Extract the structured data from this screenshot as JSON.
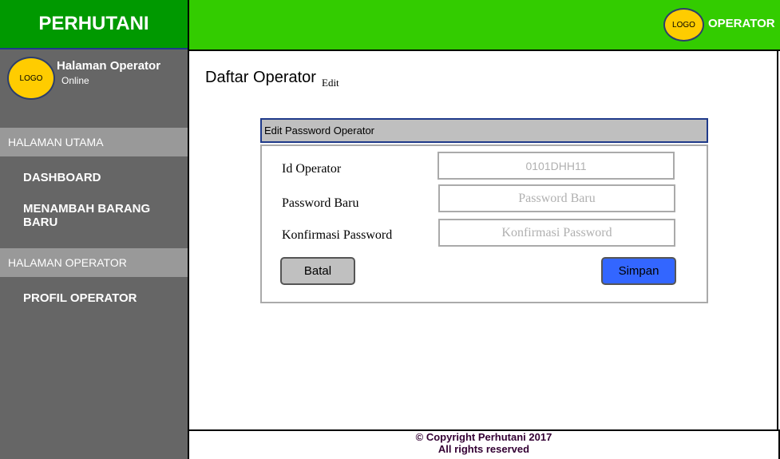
{
  "brand": {
    "name": "PERHUTANI"
  },
  "topbar": {
    "logo_text": "LOGO",
    "role": "OPERATOR"
  },
  "profile": {
    "logo_text": "LOGO",
    "name": "Halaman Operator",
    "status": "Online"
  },
  "sidebar": {
    "sections": [
      {
        "title": "HALAMAN UTAMA",
        "items": [
          "DASHBOARD",
          "MENAMBAH BARANG BARU"
        ]
      },
      {
        "title": "HALAMAN OPERATOR",
        "items": [
          "PROFIL OPERATOR"
        ]
      }
    ]
  },
  "page": {
    "title": "Daftar Operator",
    "subtitle": "Edit"
  },
  "form": {
    "header": "Edit Password Operator",
    "fields": [
      {
        "label": "Id Operator",
        "value": "0101DHH11",
        "placeholder": ""
      },
      {
        "label": "Password Baru",
        "value": "",
        "placeholder": "Password Baru"
      },
      {
        "label": "Konfirmasi Password",
        "value": "",
        "placeholder": "Konfirmasi Password"
      }
    ],
    "cancel_label": "Batal",
    "save_label": "Simpan"
  },
  "footer": {
    "line1": "© Copyright Perhutani 2017",
    "line2": "All rights reserved"
  },
  "colors": {
    "brand_green": "#009900",
    "topbar_green": "#33cc00",
    "sidebar_gray": "#666666",
    "section_gray": "#999999",
    "logo_yellow": "#ffcc00",
    "save_blue": "#3366ff"
  }
}
